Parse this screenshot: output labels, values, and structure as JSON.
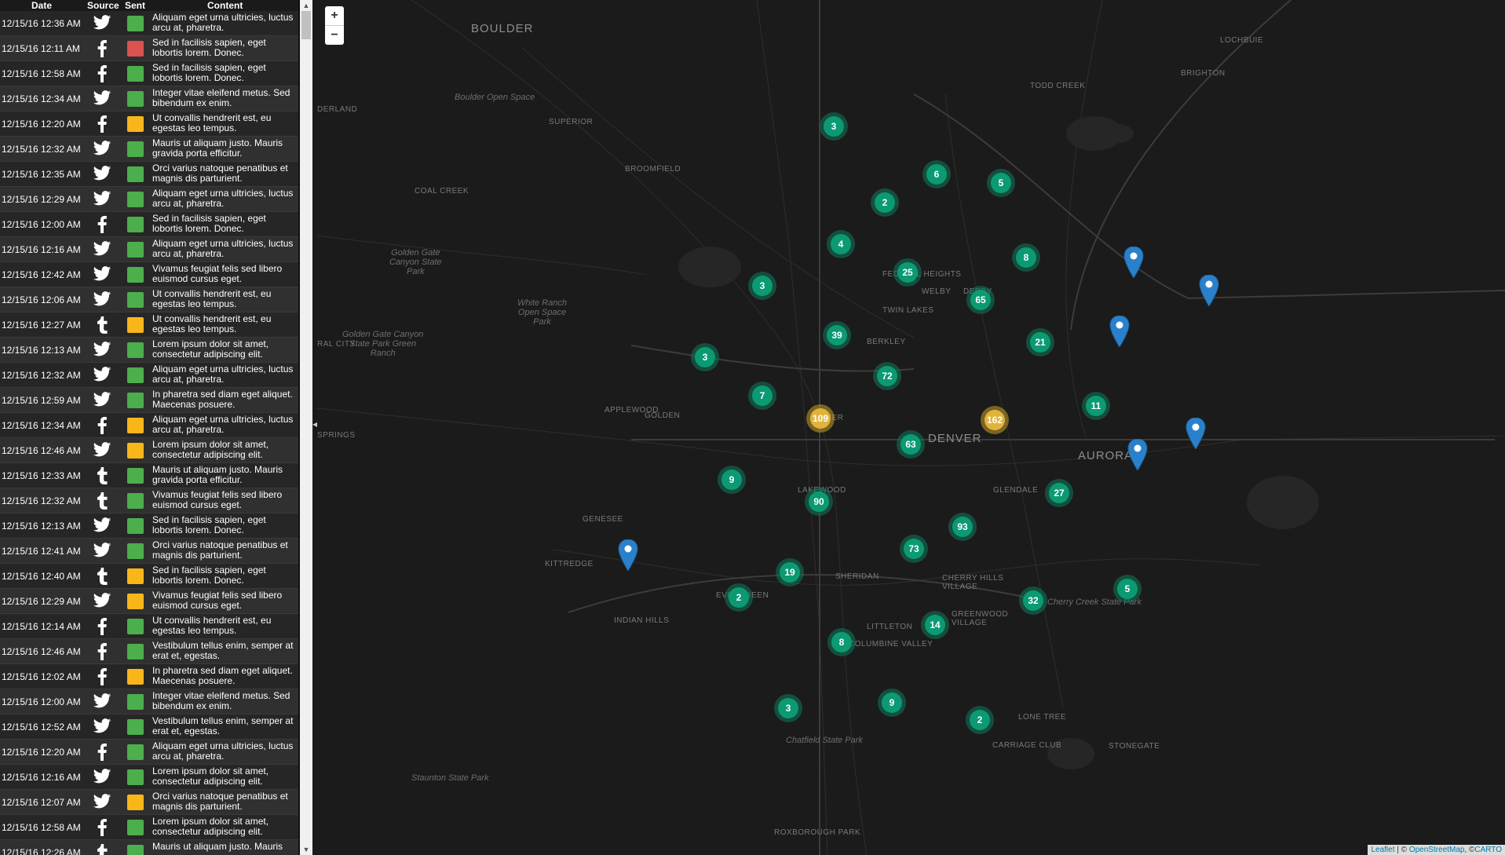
{
  "list": {
    "headers": {
      "date": "Date",
      "source": "Source",
      "sent": "Sent",
      "content": "Content"
    },
    "rows": [
      {
        "date": "12/15/16 12:36 AM",
        "source": "twitter",
        "sent": "green",
        "content": "Aliquam eget urna ultricies, luctus arcu at, pharetra."
      },
      {
        "date": "12/15/16 12:11 AM",
        "source": "facebook",
        "sent": "red",
        "content": "Sed in facilisis sapien, eget lobortis lorem. Donec."
      },
      {
        "date": "12/15/16 12:58 AM",
        "source": "facebook",
        "sent": "green",
        "content": "Sed in facilisis sapien, eget lobortis lorem. Donec."
      },
      {
        "date": "12/15/16 12:34 AM",
        "source": "twitter",
        "sent": "green",
        "content": "Integer vitae eleifend metus. Sed bibendum ex enim."
      },
      {
        "date": "12/15/16 12:20 AM",
        "source": "facebook",
        "sent": "yellow",
        "content": "Ut convallis hendrerit est, eu egestas leo tempus."
      },
      {
        "date": "12/15/16 12:32 AM",
        "source": "twitter",
        "sent": "green",
        "content": "Mauris ut aliquam justo. Mauris gravida porta efficitur."
      },
      {
        "date": "12/15/16 12:35 AM",
        "source": "twitter",
        "sent": "green",
        "content": "Orci varius natoque penatibus et magnis dis parturient."
      },
      {
        "date": "12/15/16 12:29 AM",
        "source": "twitter",
        "sent": "green",
        "content": "Aliquam eget urna ultricies, luctus arcu at, pharetra."
      },
      {
        "date": "12/15/16 12:00 AM",
        "source": "facebook",
        "sent": "green",
        "content": "Sed in facilisis sapien, eget lobortis lorem. Donec."
      },
      {
        "date": "12/15/16 12:16 AM",
        "source": "twitter",
        "sent": "green",
        "content": "Aliquam eget urna ultricies, luctus arcu at, pharetra."
      },
      {
        "date": "12/15/16 12:42 AM",
        "source": "twitter",
        "sent": "green",
        "content": "Vivamus feugiat felis sed libero euismod cursus eget."
      },
      {
        "date": "12/15/16 12:06 AM",
        "source": "twitter",
        "sent": "green",
        "content": "Ut convallis hendrerit est, eu egestas leo tempus."
      },
      {
        "date": "12/15/16 12:27 AM",
        "source": "tumblr",
        "sent": "yellow",
        "content": "Ut convallis hendrerit est, eu egestas leo tempus."
      },
      {
        "date": "12/15/16 12:13 AM",
        "source": "twitter",
        "sent": "green",
        "content": "Lorem ipsum dolor sit amet, consectetur adipiscing elit."
      },
      {
        "date": "12/15/16 12:32 AM",
        "source": "twitter",
        "sent": "green",
        "content": "Aliquam eget urna ultricies, luctus arcu at, pharetra."
      },
      {
        "date": "12/15/16 12:59 AM",
        "source": "twitter",
        "sent": "green",
        "content": "In pharetra sed diam eget aliquet. Maecenas posuere."
      },
      {
        "date": "12/15/16 12:34 AM",
        "source": "facebook",
        "sent": "yellow",
        "content": "Aliquam eget urna ultricies, luctus arcu at, pharetra."
      },
      {
        "date": "12/15/16 12:46 AM",
        "source": "twitter",
        "sent": "yellow",
        "content": "Lorem ipsum dolor sit amet, consectetur adipiscing elit."
      },
      {
        "date": "12/15/16 12:33 AM",
        "source": "tumblr",
        "sent": "green",
        "content": "Mauris ut aliquam justo. Mauris gravida porta efficitur."
      },
      {
        "date": "12/15/16 12:32 AM",
        "source": "tumblr",
        "sent": "green",
        "content": "Vivamus feugiat felis sed libero euismod cursus eget."
      },
      {
        "date": "12/15/16 12:13 AM",
        "source": "twitter",
        "sent": "green",
        "content": "Sed in facilisis sapien, eget lobortis lorem. Donec."
      },
      {
        "date": "12/15/16 12:41 AM",
        "source": "twitter",
        "sent": "green",
        "content": "Orci varius natoque penatibus et magnis dis parturient."
      },
      {
        "date": "12/15/16 12:40 AM",
        "source": "tumblr",
        "sent": "yellow",
        "content": "Sed in facilisis sapien, eget lobortis lorem. Donec."
      },
      {
        "date": "12/15/16 12:29 AM",
        "source": "twitter",
        "sent": "yellow",
        "content": "Vivamus feugiat felis sed libero euismod cursus eget."
      },
      {
        "date": "12/15/16 12:14 AM",
        "source": "facebook",
        "sent": "green",
        "content": "Ut convallis hendrerit est, eu egestas leo tempus."
      },
      {
        "date": "12/15/16 12:46 AM",
        "source": "facebook",
        "sent": "green",
        "content": "Vestibulum tellus enim, semper at erat et, egestas."
      },
      {
        "date": "12/15/16 12:02 AM",
        "source": "facebook",
        "sent": "yellow",
        "content": "In pharetra sed diam eget aliquet. Maecenas posuere."
      },
      {
        "date": "12/15/16 12:00 AM",
        "source": "twitter",
        "sent": "green",
        "content": "Integer vitae eleifend metus. Sed bibendum ex enim."
      },
      {
        "date": "12/15/16 12:52 AM",
        "source": "twitter",
        "sent": "green",
        "content": "Vestibulum tellus enim, semper at erat et, egestas."
      },
      {
        "date": "12/15/16 12:20 AM",
        "source": "facebook",
        "sent": "green",
        "content": "Aliquam eget urna ultricies, luctus arcu at, pharetra."
      },
      {
        "date": "12/15/16 12:16 AM",
        "source": "twitter",
        "sent": "green",
        "content": "Lorem ipsum dolor sit amet, consectetur adipiscing elit."
      },
      {
        "date": "12/15/16 12:07 AM",
        "source": "twitter",
        "sent": "yellow",
        "content": "Orci varius natoque penatibus et magnis dis parturient."
      },
      {
        "date": "12/15/16 12:58 AM",
        "source": "facebook",
        "sent": "green",
        "content": "Lorem ipsum dolor sit amet, consectetur adipiscing elit."
      },
      {
        "date": "12/15/16 12:26 AM",
        "source": "tumblr",
        "sent": "green",
        "content": "Mauris ut aliquam justo. Mauris"
      }
    ]
  },
  "colors": {
    "green": "#4cae4c",
    "red": "#d9534f",
    "yellow": "#f9b61a",
    "cluster_green": "#0b9a73",
    "cluster_yellow": "#e1b33c",
    "pin_blue": "#2a81cb"
  },
  "map": {
    "zoom_in": "+",
    "zoom_out": "−",
    "places": [
      {
        "name": "BOULDER",
        "kind": "big"
      },
      {
        "name": "LOCHBUIE",
        "kind": "small"
      },
      {
        "name": "BRIGHTON",
        "kind": "small"
      },
      {
        "name": "TODD CREEK",
        "kind": "small"
      },
      {
        "name": "Boulder Open Space",
        "kind": "park"
      },
      {
        "name": "DERLAND",
        "kind": "small"
      },
      {
        "name": "SUPERIOR",
        "kind": "small"
      },
      {
        "name": "BROOMFIELD",
        "kind": "small"
      },
      {
        "name": "COAL CREEK",
        "kind": "small"
      },
      {
        "name": "Golden Gate\nCanyon State\nPark",
        "kind": "park"
      },
      {
        "name": "White Ranch\nOpen Space\nPark",
        "kind": "park"
      },
      {
        "name": "Golden Gate Canyon\nState Park Green\nRanch",
        "kind": "park"
      },
      {
        "name": "FEDERAL HEIGHTS",
        "kind": "small"
      },
      {
        "name": "WELBY",
        "kind": "small"
      },
      {
        "name": "DERBY",
        "kind": "small"
      },
      {
        "name": "TWIN LAKES",
        "kind": "small"
      },
      {
        "name": "BERKLEY",
        "kind": "small"
      },
      {
        "name": "RAL CITY",
        "kind": "small"
      },
      {
        "name": "GOLDEN",
        "kind": "small"
      },
      {
        "name": "APPLEWOOD",
        "kind": "small"
      },
      {
        "name": "SPRINGS",
        "kind": "small"
      },
      {
        "name": "WATER",
        "kind": "small"
      },
      {
        "name": "DENVER",
        "kind": "big"
      },
      {
        "name": "AURORA",
        "kind": "big"
      },
      {
        "name": "GLENDALE",
        "kind": "small"
      },
      {
        "name": "LAKEWOOD",
        "kind": "small"
      },
      {
        "name": "GENESEE",
        "kind": "small"
      },
      {
        "name": "KITTREDGE",
        "kind": "small"
      },
      {
        "name": "EVERGREEN",
        "kind": "small"
      },
      {
        "name": "SHERIDAN",
        "kind": "small"
      },
      {
        "name": "CHERRY HILLS\nVILLAGE",
        "kind": "small"
      },
      {
        "name": "GREENWOOD\nVILLAGE",
        "kind": "small"
      },
      {
        "name": "Cherry Creek State Park",
        "kind": "park"
      },
      {
        "name": "INDIAN HILLS",
        "kind": "small"
      },
      {
        "name": "LITTLETON",
        "kind": "small"
      },
      {
        "name": "COLUMBINE VALLEY",
        "kind": "small"
      },
      {
        "name": "LONE TREE",
        "kind": "small"
      },
      {
        "name": "CARRIAGE CLUB",
        "kind": "small"
      },
      {
        "name": "STONEGATE",
        "kind": "small"
      },
      {
        "name": "Chatfield State Park",
        "kind": "park"
      },
      {
        "name": "Staunton State Park",
        "kind": "park"
      },
      {
        "name": "ROXBOROUGH PARK",
        "kind": "small"
      }
    ],
    "clusters": [
      {
        "count": "3",
        "color": "green"
      },
      {
        "count": "6",
        "color": "green"
      },
      {
        "count": "5",
        "color": "green"
      },
      {
        "count": "2",
        "color": "green"
      },
      {
        "count": "4",
        "color": "green"
      },
      {
        "count": "8",
        "color": "green"
      },
      {
        "count": "25",
        "color": "green"
      },
      {
        "count": "3",
        "color": "green"
      },
      {
        "count": "65",
        "color": "green"
      },
      {
        "count": "39",
        "color": "green"
      },
      {
        "count": "21",
        "color": "green"
      },
      {
        "count": "3",
        "color": "green"
      },
      {
        "count": "72",
        "color": "green"
      },
      {
        "count": "7",
        "color": "green"
      },
      {
        "count": "109",
        "color": "yellow"
      },
      {
        "count": "162",
        "color": "yellow"
      },
      {
        "count": "11",
        "color": "green"
      },
      {
        "count": "63",
        "color": "green"
      },
      {
        "count": "9",
        "color": "green"
      },
      {
        "count": "27",
        "color": "green"
      },
      {
        "count": "90",
        "color": "green"
      },
      {
        "count": "93",
        "color": "green"
      },
      {
        "count": "73",
        "color": "green"
      },
      {
        "count": "19",
        "color": "green"
      },
      {
        "count": "2",
        "color": "green"
      },
      {
        "count": "5",
        "color": "green"
      },
      {
        "count": "32",
        "color": "green"
      },
      {
        "count": "14",
        "color": "green"
      },
      {
        "count": "8",
        "color": "green"
      },
      {
        "count": "9",
        "color": "green"
      },
      {
        "count": "3",
        "color": "green"
      },
      {
        "count": "2",
        "color": "green"
      }
    ],
    "pin_count": 6,
    "attribution": {
      "leaflet": "Leaflet",
      "sep": " | © ",
      "osm": "OpenStreetMap",
      "sep2": ", ©",
      "carto": "CARTO"
    }
  }
}
